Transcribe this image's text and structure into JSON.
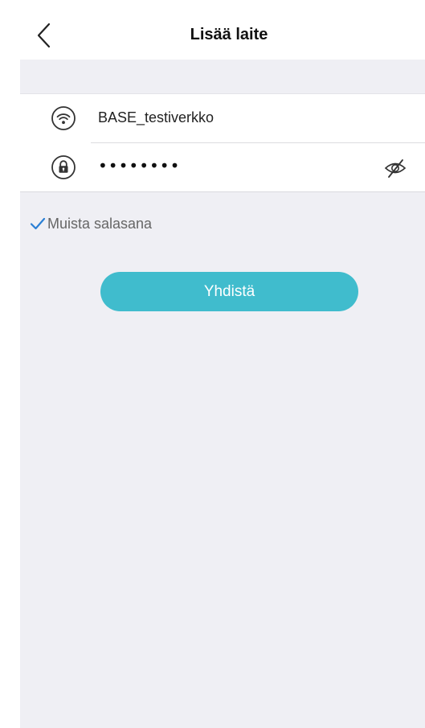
{
  "header": {
    "title": "Lisää laite",
    "back_icon": "chevron-left-icon"
  },
  "form": {
    "ssid": {
      "icon": "wifi-icon",
      "value": "BASE_testiverkko"
    },
    "password": {
      "icon": "lock-icon",
      "masked_value": "••••••••",
      "visibility_icon": "eye-off-icon"
    }
  },
  "remember": {
    "label": "Muista salasana",
    "checked": true
  },
  "connect_button": {
    "label": "Yhdistä"
  },
  "colors": {
    "accent": "#40bccd",
    "background": "#efeff4",
    "checkmark": "#2a7fd4"
  }
}
